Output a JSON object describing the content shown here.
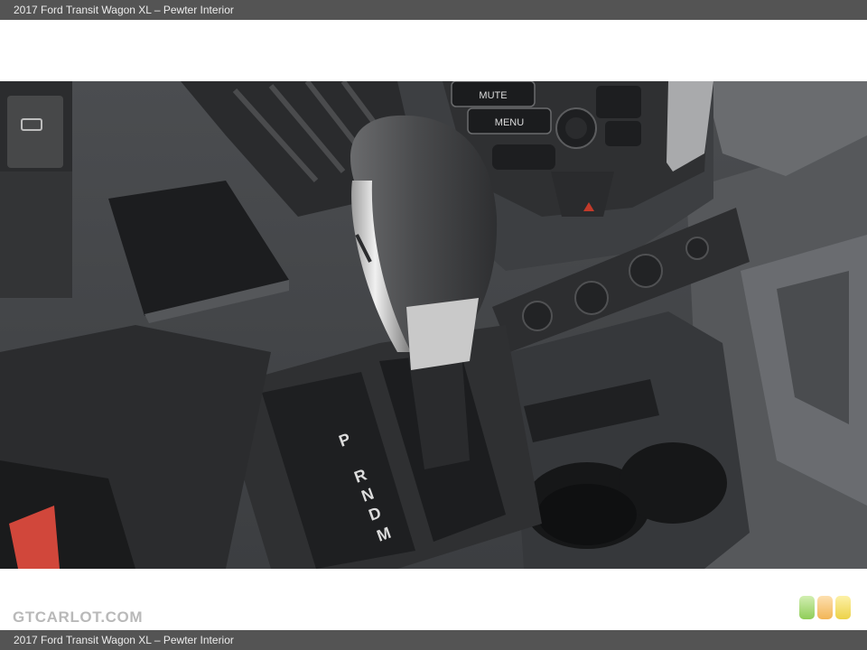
{
  "caption": {
    "top": "2017 Ford Transit Wagon XL – Pewter Interior",
    "bottom": "2017 Ford Transit Wagon XL – Pewter Interior"
  },
  "watermark": {
    "text": "GTCARLOT.COM"
  },
  "photo": {
    "console_buttons": [
      "MUTE",
      "MENU"
    ],
    "gear_letters": [
      "P",
      "R",
      "N",
      "D",
      "M"
    ]
  },
  "rating_dots": {
    "colors": [
      "#8fcd58",
      "#f2b556",
      "#ecd248"
    ]
  }
}
